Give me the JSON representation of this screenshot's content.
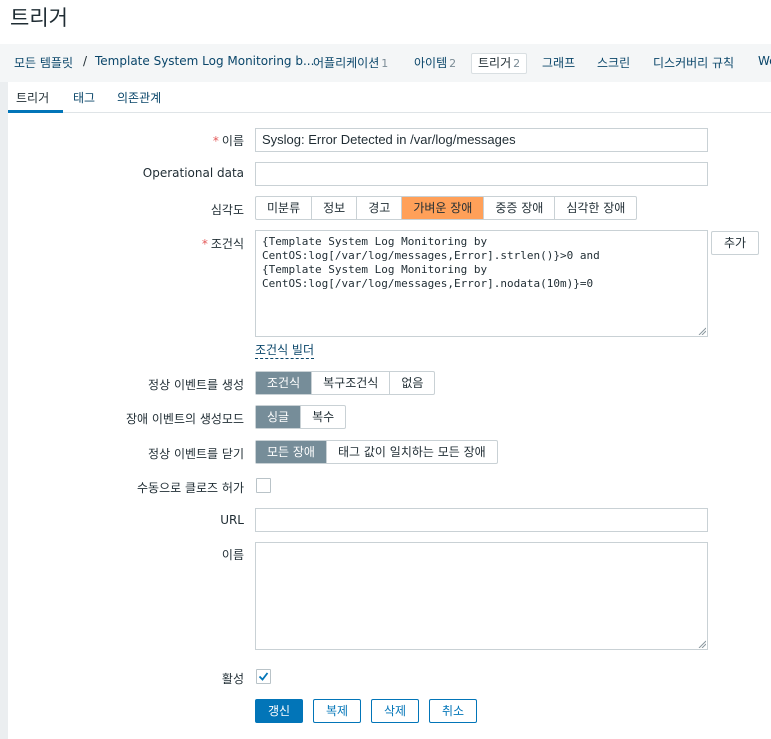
{
  "page_title": "트리거",
  "nav": {
    "all_templates": "모든 템플릿",
    "separator": "/",
    "template_name": "Template System Log Monitoring b...",
    "items": [
      {
        "label": "어플리케이션",
        "count": "1"
      },
      {
        "label": "아이템",
        "count": "2"
      },
      {
        "label": "트리거",
        "count": "2"
      },
      {
        "label": "그래프",
        "count": ""
      },
      {
        "label": "스크린",
        "count": ""
      },
      {
        "label": "디스커버리 규칙",
        "count": ""
      },
      {
        "label": "We",
        "count": ""
      }
    ]
  },
  "tabs": [
    "트리거",
    "태그",
    "의존관계"
  ],
  "form": {
    "name_label": "이름",
    "name_value": "Syslog: Error Detected in /var/log/messages",
    "opdata_label": "Operational data",
    "opdata_value": "",
    "severity_label": "심각도",
    "severity_options": [
      "미분류",
      "정보",
      "경고",
      "가벼운 장애",
      "중증 장애",
      "심각한 장애"
    ],
    "severity_selected": "가벼운 장애",
    "expression_label": "조건식",
    "expression_value": "{Template System Log Monitoring by\nCentOS:log[/var/log/messages,Error].strlen()}>0 and\n{Template System Log Monitoring by\nCentOS:log[/var/log/messages,Error].nodata(10m)}=0",
    "add_button": "추가",
    "expression_builder_link": "조건식 빌더",
    "ok_event_label": "정상 이벤트를 생성",
    "ok_event_options": [
      "조건식",
      "복구조건식",
      "없음"
    ],
    "problem_mode_label": "장애 이벤트의 생성모드",
    "problem_mode_options": [
      "싱글",
      "복수"
    ],
    "ok_close_label": "정상 이벤트를 닫기",
    "ok_close_options": [
      "모든 장애",
      "태그 값이 일치하는 모든 장애"
    ],
    "manual_close_label": "수동으로 클로즈 허가",
    "manual_close_checked": false,
    "url_label": "URL",
    "url_value": "",
    "description_label": "이름",
    "description_value": "",
    "enabled_label": "활성",
    "enabled_checked": true
  },
  "buttons": {
    "update": "갱신",
    "clone": "복제",
    "delete": "삭제",
    "cancel": "취소"
  },
  "colors": {
    "accent": "#0275b8",
    "selected_segment": "#768d99",
    "severity_average": "#ffa059",
    "required_marker": "#e45959",
    "link": "#0a466a"
  }
}
